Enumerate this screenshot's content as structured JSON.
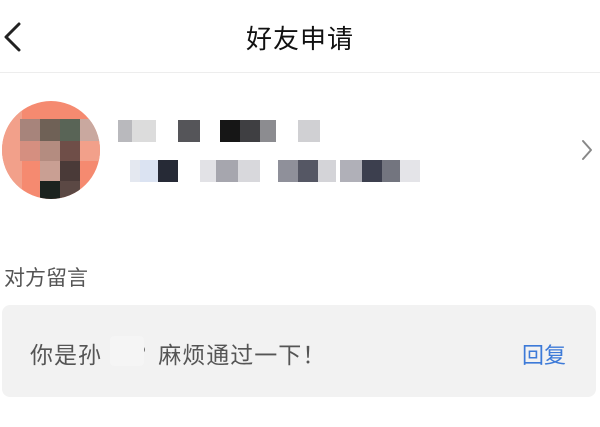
{
  "header": {
    "title": "好友申请",
    "back_icon": "chevron-left-icon"
  },
  "requester": {
    "name": "",
    "id": "",
    "avatar_color": "#f58a70",
    "chevron_icon": "chevron-right-icon"
  },
  "message_section": {
    "label": "对方留言",
    "message": "你是孙  吗？麻烦通过一下！",
    "reply_label": "回复",
    "reply_color": "#3d7ad8"
  }
}
